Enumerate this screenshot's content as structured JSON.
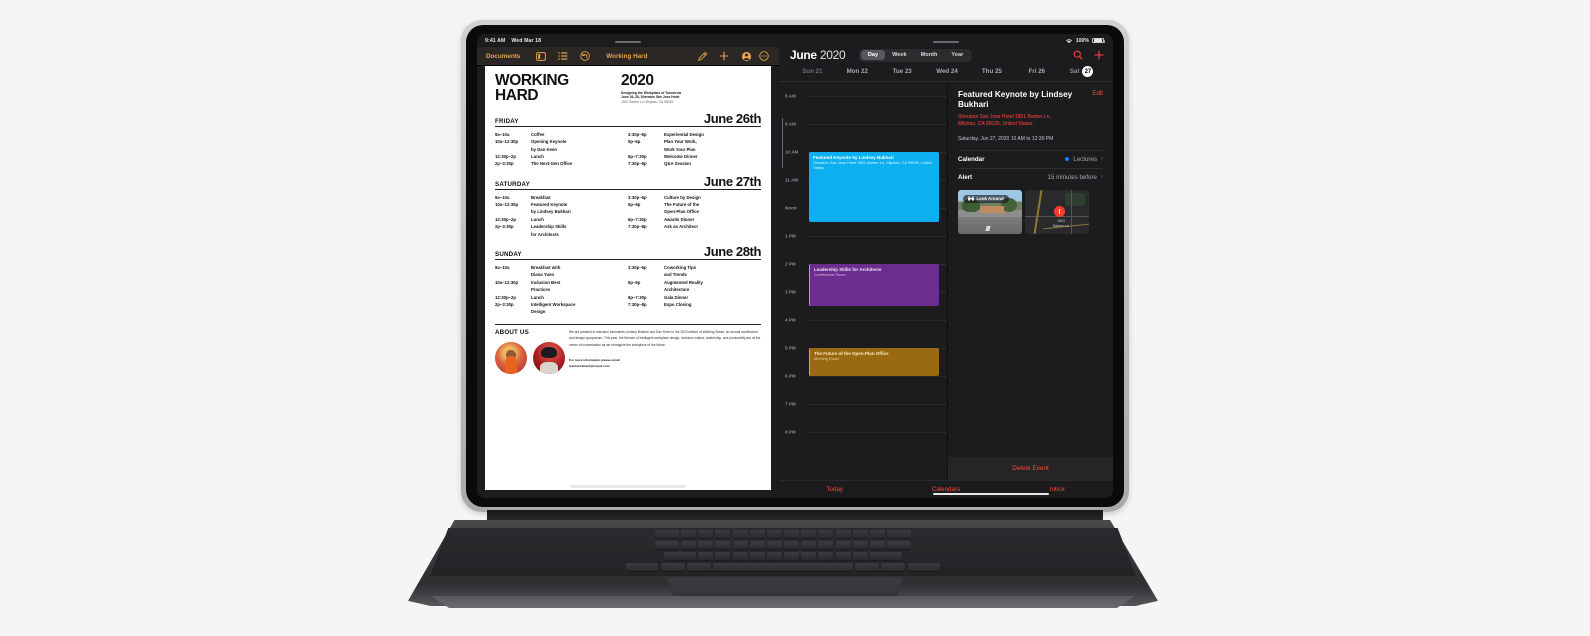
{
  "device": {
    "name": "iPad Pro with Magic Keyboard"
  },
  "status_bar": {
    "time": "9:41 AM",
    "date": "Wed Mar 18",
    "wifi_icon": "wifi-icon",
    "battery_percent": "100%",
    "battery_icon": "battery-full-icon"
  },
  "pages_app": {
    "toolbar": {
      "back_label": "Documents",
      "sidebar_icon": "sidebar-panel-icon",
      "list_icon": "list-view-icon",
      "undo_icon": "undo-icon",
      "document_title": "Working Hard",
      "markup_icon": "pen-markup-icon",
      "insert_icon": "plus-icon",
      "collaborate_icon": "collaborate-person-icon",
      "more_icon": "more-ellipsis-icon"
    },
    "document": {
      "title_line1": "WORKING",
      "title_line2": "HARD",
      "year": "2020",
      "subtitle_line1": "Designing the Workplace of Tomorrow",
      "subtitle_line2": "June 26–28, Sheraton San Jose Hotel",
      "subtitle_line3": "1801 Barber Ln, Milpitas, CA 95035",
      "days": [
        {
          "weekday": "FRIDAY",
          "date": "June 26th",
          "left": {
            "times": [
              "9a–10a",
              "10a–12:30p",
              "",
              "12:30p–2p",
              "2p–3:30p"
            ],
            "items": [
              "Coffee",
              "Opening Keynote",
              "by Dan Keen",
              "Lunch",
              "The Next-Gen Office"
            ]
          },
          "right": {
            "times": [
              "3:30p–5p",
              "5p–6p",
              "",
              "6p–7:30p",
              "7:30p–8p"
            ],
            "items": [
              "Experiential Design",
              "Plan Your Work,",
              "Work Your Plan",
              "Welcome Dinner",
              "Q&A Session"
            ]
          }
        },
        {
          "weekday": "SATURDAY",
          "date": "June 27th",
          "left": {
            "times": [
              "9a–10a",
              "10a–12:30p",
              "",
              "12:30p–2p",
              "2p–3:30p",
              ""
            ],
            "items": [
              "Breakfast",
              "Featured Keynote",
              "by Lindsey Bukhari",
              "Lunch",
              "Leadership Skills",
              "for Architects"
            ]
          },
          "right": {
            "times": [
              "3:30p–5p",
              "5p–6p",
              "",
              "6p–7:30p",
              "7:30p–8p",
              ""
            ],
            "items": [
              "Culture by Design",
              "The Future of the",
              "Open-Plan Office",
              "Awards Dinner",
              "Ask an Architect",
              ""
            ]
          }
        },
        {
          "weekday": "SUNDAY",
          "date": "June 28th",
          "left": {
            "times": [
              "9a–10a",
              "",
              "10a–12:30p",
              "",
              "12:30p–2p",
              "2p–3:30p",
              ""
            ],
            "items": [
              "Breakfast with",
              "Diana Yuen",
              "Inclusion Best",
              "Practices",
              "Lunch",
              "Intelligent Workspace",
              "Design"
            ]
          },
          "right": {
            "times": [
              "3:30p–5p",
              "",
              "5p–6p",
              "",
              "6p–7:30p",
              "7:30p–8p",
              ""
            ],
            "items": [
              "Coworking Tips",
              "and Trends",
              "Augmented Reality",
              "Architecture",
              "Gala Dinner",
              "Expo Closing",
              ""
            ]
          }
        }
      ],
      "about": {
        "heading": "ABOUT US",
        "body": "We are pleased to welcome luminaries Lindsey Bukhari and Dan Keen to the 2020 edition of Working Smart, an annual architecture and design symposium. This year, the themes of intelligent workplace design, inclusive culture, leadership, and productivity are at the center of conversation as we reimagine the workplace of the future.",
        "footer_line1": "For more information please email",
        "footer_line2": "teamworkhard@icloud.com",
        "avatar1": "avatar-person-1",
        "avatar2": "avatar-person-2"
      }
    }
  },
  "calendar_app": {
    "month": "June",
    "year": "2020",
    "view_options": [
      "Day",
      "Week",
      "Month",
      "Year"
    ],
    "active_view": "Day",
    "search_icon": "search-icon",
    "add_icon": "plus-icon",
    "week_days": [
      {
        "label": "Sun 21",
        "state": "dim"
      },
      {
        "label": "Mon 22",
        "state": "normal"
      },
      {
        "label": "Tue 23",
        "state": "normal"
      },
      {
        "label": "Wed 24",
        "state": "normal"
      },
      {
        "label": "Thu 25",
        "state": "normal"
      },
      {
        "label": "Fri 26",
        "state": "normal"
      },
      {
        "label": "Sat",
        "state": "selected",
        "day_number": "27"
      }
    ],
    "hours": [
      "8 AM",
      "9 AM",
      "10 AM",
      "11 AM",
      "Noon",
      "1 PM",
      "2 PM",
      "3 PM",
      "4 PM",
      "5 PM",
      "6 PM",
      "7 PM",
      "8 PM"
    ],
    "events": [
      {
        "title": "Featured Keynote by Lindsey Bukhari",
        "subtitle": "Sheraton San Jose Hotel 1801 Barber Ln, Milpitas, CA  95035, United States",
        "color": "#0cb0f0",
        "start_hour": "10 AM",
        "end_hour": "12:30 PM"
      },
      {
        "title": "Leadership Skills for Architects",
        "subtitle": "Conference Room",
        "color": "#6b2d8e",
        "start_hour": "2 PM",
        "end_hour": "3:30 PM"
      },
      {
        "title": "The Future of the Open-Plan Office",
        "subtitle": "Meeting Room",
        "color": "#9a6a12",
        "start_hour": "5 PM",
        "end_hour": "6 PM"
      }
    ],
    "detail": {
      "title": "Featured Keynote by Lindsey Bukhari",
      "edit_label": "Edit",
      "address_line1": "Sheraton San Jose Hotel 1801 Barber Ln,",
      "address_line2": "Milpitas, CA  95035, United States",
      "when": "Saturday, Jun 27, 2020  10 AM to 12:30 PM",
      "calendar_label": "Calendar",
      "calendar_value": "Lectures",
      "calendar_color": "#0a84ff",
      "alert_label": "Alert",
      "alert_value": "15 minutes before",
      "look_around_label": "Look Around",
      "look_around_icon": "binoculars-icon",
      "map_pin_icon": "map-pin-icon",
      "map_label_line1": "1801",
      "map_label_line2": "Barber Ln",
      "delete_label": "Delete Event"
    },
    "tab_bar": [
      "Today",
      "Calendars",
      "Inbox"
    ]
  }
}
